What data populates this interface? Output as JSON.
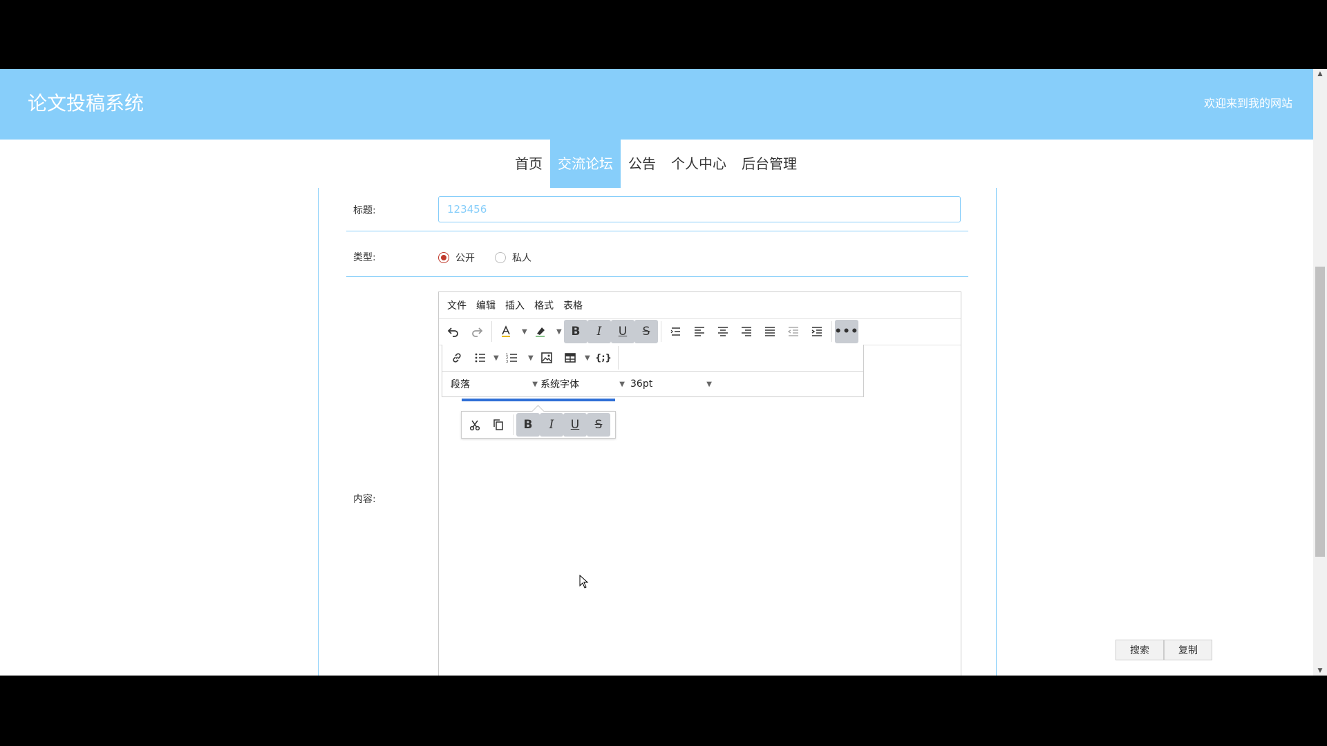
{
  "header": {
    "site_title": "论文投稿系统",
    "welcome": "欢迎来到我的网站",
    "bg_color": "#87cefa"
  },
  "nav": {
    "items": [
      "首页",
      "交流论坛",
      "公告",
      "个人中心",
      "后台管理"
    ],
    "active": "交流论坛"
  },
  "form": {
    "title_label": "标题:",
    "title_value": "123456",
    "type_label": "类型:",
    "type_options": [
      "公开",
      "私人"
    ],
    "type_selected": "公开",
    "content_label": "内容:"
  },
  "editor": {
    "menus": [
      "文件",
      "编辑",
      "插入",
      "格式",
      "表格"
    ],
    "block_format": "段落",
    "font_family": "系统字体",
    "font_size": "36pt"
  },
  "side_buttons": {
    "search": "搜索",
    "copy": "复制"
  },
  "colors": {
    "accent": "#87cefa",
    "radio_checked": "#c0392b",
    "selection": "#2f6fd6"
  },
  "icons": [
    "undo-icon",
    "redo-icon",
    "text-color-icon",
    "highlight-icon",
    "bold-icon",
    "italic-icon",
    "underline-icon",
    "strikethrough-icon",
    "line-height-icon",
    "align-left-icon",
    "align-center-icon",
    "align-right-icon",
    "align-justify-icon",
    "outdent-icon",
    "indent-icon",
    "more-icon",
    "link-icon",
    "bullet-list-icon",
    "numbered-list-icon",
    "image-icon",
    "table-icon",
    "code-sample-icon",
    "cut-icon",
    "copy-icon",
    "mouse-cursor-icon"
  ]
}
